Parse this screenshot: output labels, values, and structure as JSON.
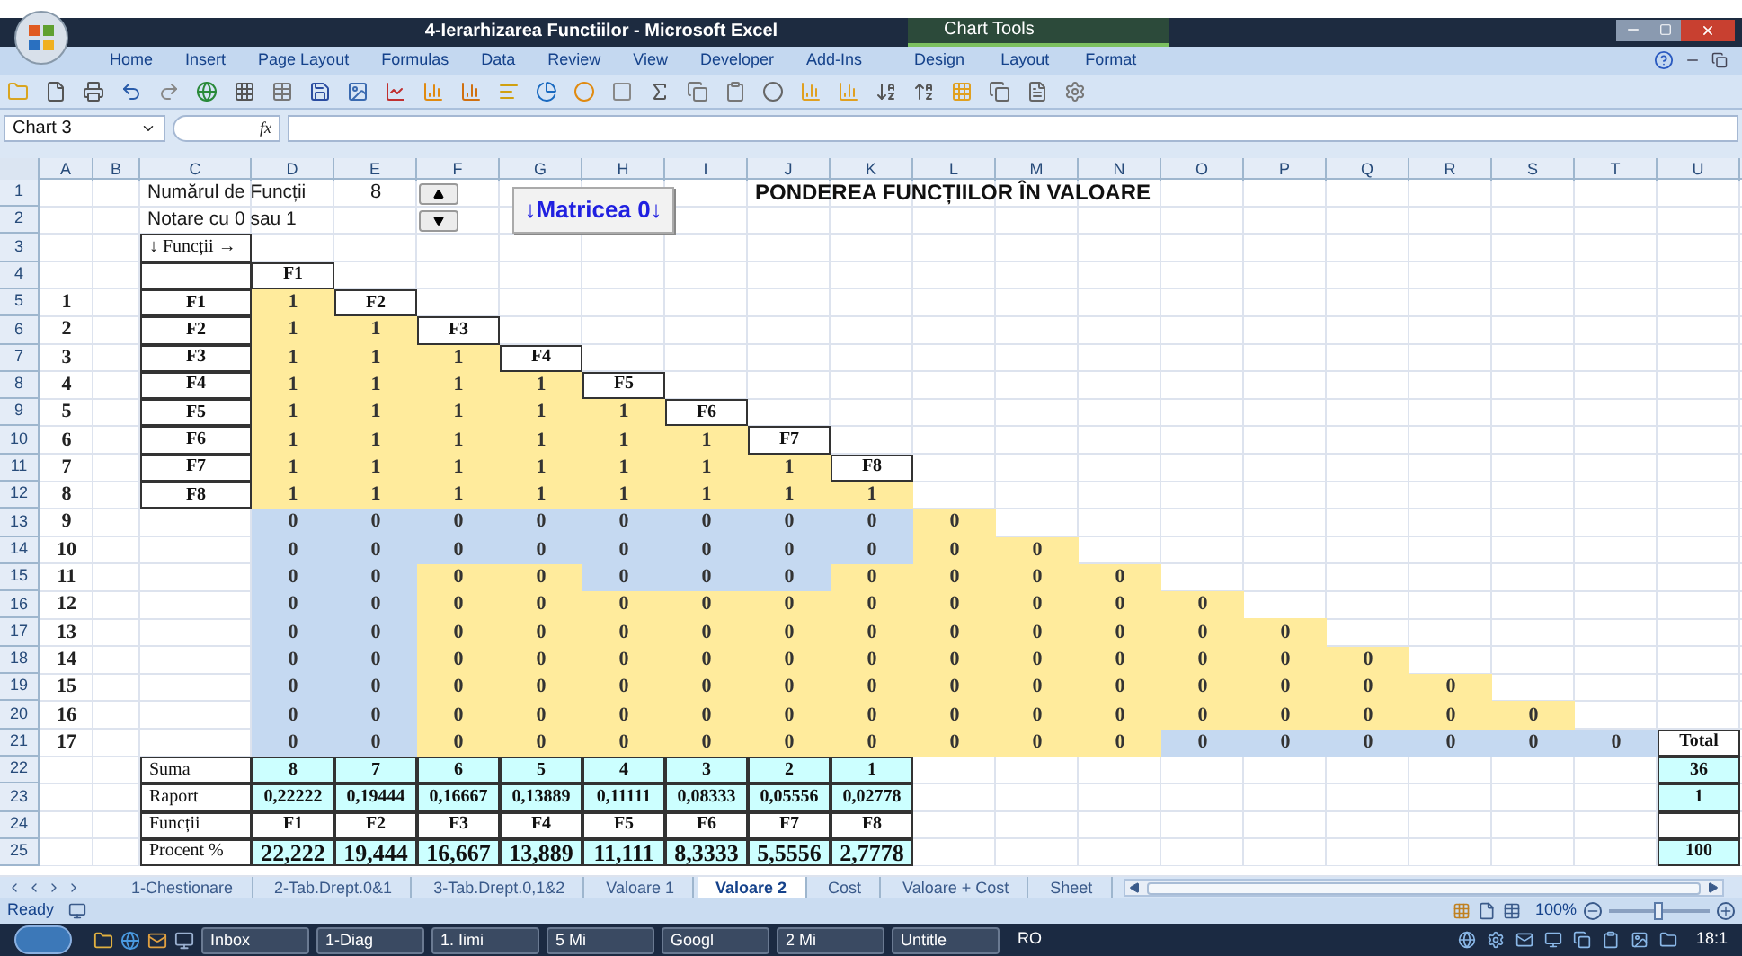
{
  "window": {
    "title": "4-Ierarhizarea Functiilor - Microsoft Excel"
  },
  "ribbon_tabs": [
    "Home",
    "Insert",
    "Page Layout",
    "Formulas",
    "Data",
    "Review",
    "View",
    "Developer",
    "Add-Ins"
  ],
  "contextual": {
    "title": "Chart Tools",
    "tabs": [
      "Design",
      "Layout",
      "Format"
    ]
  },
  "formula_bar": {
    "name_box": "Chart 3",
    "fx_label": "fx"
  },
  "columns": [
    "A",
    "B",
    "C",
    "D",
    "E",
    "F",
    "G",
    "H",
    "I",
    "J",
    "K",
    "L",
    "M",
    "N",
    "O",
    "P",
    "Q",
    "R",
    "S",
    "T",
    "U"
  ],
  "rows": [
    {
      "number": "1",
      "cells": [
        {},
        {},
        {
          "kind": "plain",
          "text": "Numărul de Funcții"
        },
        {},
        {
          "kind": "center",
          "text": "8"
        },
        {},
        {},
        {},
        {},
        {
          "kind": "title",
          "text": "PONDEREA FUNCȚIILOR ÎN VALOARE"
        },
        {},
        {},
        {},
        {},
        {},
        {},
        {},
        {},
        {},
        {},
        {}
      ]
    },
    {
      "number": "2",
      "cells": [
        {},
        {},
        {
          "kind": "plain",
          "text": "Notare cu 0 sau 1"
        },
        {},
        {},
        {},
        {},
        {},
        {},
        {},
        {},
        {},
        {},
        {},
        {},
        {},
        {},
        {},
        {},
        {},
        {}
      ]
    },
    {
      "number": "3",
      "cells": [
        {},
        {},
        {
          "kind": "label",
          "text": "↓ Funcții →"
        },
        {},
        {},
        {},
        {},
        {},
        {},
        {},
        {},
        {},
        {},
        {},
        {},
        {},
        {},
        {},
        {},
        {},
        {}
      ]
    },
    {
      "number": "4",
      "cells": [
        {},
        {},
        {
          "kind": "boxed"
        },
        {
          "kind": "boxed",
          "text": "F1"
        },
        {},
        {},
        {},
        {},
        {},
        {},
        {},
        {},
        {},
        {},
        {},
        {},
        {},
        {},
        {},
        {},
        {}
      ]
    },
    {
      "number": "5",
      "cells": [
        {
          "kind": "number",
          "text": "1"
        },
        {},
        {
          "kind": "boxed",
          "text": "F1"
        },
        {
          "kind": "yellow",
          "text": "1"
        },
        {
          "kind": "boxed",
          "text": "F2"
        },
        {},
        {},
        {},
        {},
        {},
        {},
        {},
        {},
        {},
        {},
        {},
        {},
        {},
        {},
        {},
        {}
      ]
    },
    {
      "number": "6",
      "cells": [
        {
          "kind": "number",
          "text": "2"
        },
        {},
        {
          "kind": "boxed",
          "text": "F2"
        },
        {
          "kind": "yellow",
          "text": "1"
        },
        {
          "kind": "yellow",
          "text": "1"
        },
        {
          "kind": "boxed",
          "text": "F3"
        },
        {},
        {},
        {},
        {},
        {},
        {},
        {},
        {},
        {},
        {},
        {},
        {},
        {},
        {},
        {}
      ]
    },
    {
      "number": "7",
      "cells": [
        {
          "kind": "number",
          "text": "3"
        },
        {},
        {
          "kind": "boxed",
          "text": "F3"
        },
        {
          "kind": "yellow",
          "text": "1"
        },
        {
          "kind": "yellow",
          "text": "1"
        },
        {
          "kind": "yellow",
          "text": "1"
        },
        {
          "kind": "boxed",
          "text": "F4"
        },
        {},
        {},
        {},
        {},
        {},
        {},
        {},
        {},
        {},
        {},
        {},
        {},
        {},
        {}
      ]
    },
    {
      "number": "8",
      "cells": [
        {
          "kind": "number",
          "text": "4"
        },
        {},
        {
          "kind": "boxed",
          "text": "F4"
        },
        {
          "kind": "yellow",
          "text": "1"
        },
        {
          "kind": "yellow",
          "text": "1"
        },
        {
          "kind": "yellow",
          "text": "1"
        },
        {
          "kind": "yellow",
          "text": "1"
        },
        {
          "kind": "boxed",
          "text": "F5"
        },
        {},
        {},
        {},
        {},
        {},
        {},
        {},
        {},
        {},
        {},
        {},
        {},
        {}
      ]
    },
    {
      "number": "9",
      "cells": [
        {
          "kind": "number",
          "text": "5"
        },
        {},
        {
          "kind": "boxed",
          "text": "F5"
        },
        {
          "kind": "yellow",
          "text": "1"
        },
        {
          "kind": "yellow",
          "text": "1"
        },
        {
          "kind": "yellow",
          "text": "1"
        },
        {
          "kind": "yellow",
          "text": "1"
        },
        {
          "kind": "yellow",
          "text": "1"
        },
        {
          "kind": "boxed",
          "text": "F6"
        },
        {},
        {},
        {},
        {},
        {},
        {},
        {},
        {},
        {},
        {},
        {},
        {}
      ]
    },
    {
      "number": "10",
      "cells": [
        {
          "kind": "number",
          "text": "6"
        },
        {},
        {
          "kind": "boxed",
          "text": "F6"
        },
        {
          "kind": "yellow",
          "text": "1"
        },
        {
          "kind": "yellow",
          "text": "1"
        },
        {
          "kind": "yellow",
          "text": "1"
        },
        {
          "kind": "yellow",
          "text": "1"
        },
        {
          "kind": "yellow",
          "text": "1"
        },
        {
          "kind": "yellow",
          "text": "1"
        },
        {
          "kind": "boxed",
          "text": "F7"
        },
        {},
        {},
        {},
        {},
        {},
        {},
        {},
        {},
        {},
        {},
        {}
      ]
    },
    {
      "number": "11",
      "cells": [
        {
          "kind": "number",
          "text": "7"
        },
        {},
        {
          "kind": "boxed",
          "text": "F7"
        },
        {
          "kind": "yellow",
          "text": "1"
        },
        {
          "kind": "yellow",
          "text": "1"
        },
        {
          "kind": "yellow",
          "text": "1"
        },
        {
          "kind": "yellow",
          "text": "1"
        },
        {
          "kind": "yellow",
          "text": "1"
        },
        {
          "kind": "yellow",
          "text": "1"
        },
        {
          "kind": "yellow",
          "text": "1"
        },
        {
          "kind": "boxed",
          "text": "F8"
        },
        {},
        {},
        {},
        {},
        {},
        {},
        {},
        {},
        {},
        {}
      ]
    },
    {
      "number": "12",
      "cells": [
        {
          "kind": "number",
          "text": "8"
        },
        {},
        {
          "kind": "boxed",
          "text": "F8"
        },
        {
          "kind": "yellow",
          "text": "1"
        },
        {
          "kind": "yellow",
          "text": "1"
        },
        {
          "kind": "yellow",
          "text": "1"
        },
        {
          "kind": "yellow",
          "text": "1"
        },
        {
          "kind": "yellow",
          "text": "1"
        },
        {
          "kind": "yellow",
          "text": "1"
        },
        {
          "kind": "yellow",
          "text": "1"
        },
        {
          "kind": "yellow",
          "text": "1"
        },
        {},
        {},
        {},
        {},
        {},
        {},
        {},
        {},
        {},
        {}
      ]
    },
    {
      "number": "13",
      "cells": [
        {
          "kind": "number",
          "text": "9"
        },
        {},
        {},
        {
          "kind": "blue",
          "text": "0"
        },
        {
          "kind": "blue",
          "text": "0"
        },
        {
          "kind": "blue",
          "text": "0"
        },
        {
          "kind": "blue",
          "text": "0"
        },
        {
          "kind": "blue",
          "text": "0"
        },
        {
          "kind": "blue",
          "text": "0"
        },
        {
          "kind": "blue",
          "text": "0"
        },
        {
          "kind": "blue",
          "text": "0"
        },
        {
          "kind": "yellow",
          "text": "0"
        },
        {},
        {},
        {},
        {},
        {},
        {},
        {},
        {},
        {}
      ]
    },
    {
      "number": "14",
      "cells": [
        {
          "kind": "number",
          "text": "10"
        },
        {},
        {},
        {
          "kind": "blue",
          "text": "0"
        },
        {
          "kind": "blue",
          "text": "0"
        },
        {
          "kind": "blue",
          "text": "0"
        },
        {
          "kind": "blue",
          "text": "0"
        },
        {
          "kind": "blue",
          "text": "0"
        },
        {
          "kind": "blue",
          "text": "0"
        },
        {
          "kind": "blue",
          "text": "0"
        },
        {
          "kind": "blue",
          "text": "0"
        },
        {
          "kind": "yellow",
          "text": "0"
        },
        {
          "kind": "yellow",
          "text": "0"
        },
        {},
        {},
        {},
        {},
        {},
        {},
        {},
        {}
      ]
    },
    {
      "number": "15",
      "cells": [
        {
          "kind": "number",
          "text": "11"
        },
        {},
        {},
        {
          "kind": "blue",
          "text": "0"
        },
        {
          "kind": "blue",
          "text": "0"
        },
        {
          "kind": "yellow",
          "text": "0"
        },
        {
          "kind": "yellow",
          "text": "0"
        },
        {
          "kind": "blue",
          "text": "0"
        },
        {
          "kind": "blue",
          "text": "0"
        },
        {
          "kind": "blue",
          "text": "0"
        },
        {
          "kind": "yellow",
          "text": "0"
        },
        {
          "kind": "yellow",
          "text": "0"
        },
        {
          "kind": "yellow",
          "text": "0"
        },
        {
          "kind": "yellow",
          "text": "0"
        },
        {},
        {},
        {},
        {},
        {},
        {},
        {}
      ]
    },
    {
      "number": "16",
      "cells": [
        {
          "kind": "number",
          "text": "12"
        },
        {},
        {},
        {
          "kind": "blue",
          "text": "0"
        },
        {
          "kind": "blue",
          "text": "0"
        },
        {
          "kind": "yellow",
          "text": "0"
        },
        {
          "kind": "yellow",
          "text": "0"
        },
        {
          "kind": "yellow",
          "text": "0"
        },
        {
          "kind": "yellow",
          "text": "0"
        },
        {
          "kind": "yellow",
          "text": "0"
        },
        {
          "kind": "yellow",
          "text": "0"
        },
        {
          "kind": "yellow",
          "text": "0"
        },
        {
          "kind": "yellow",
          "text": "0"
        },
        {
          "kind": "yellow",
          "text": "0"
        },
        {
          "kind": "yellow",
          "text": "0"
        },
        {},
        {},
        {},
        {},
        {},
        {}
      ]
    },
    {
      "number": "17",
      "cells": [
        {
          "kind": "number",
          "text": "13"
        },
        {},
        {},
        {
          "kind": "blue",
          "text": "0"
        },
        {
          "kind": "blue",
          "text": "0"
        },
        {
          "kind": "yellow",
          "text": "0"
        },
        {
          "kind": "yellow",
          "text": "0"
        },
        {
          "kind": "yellow",
          "text": "0"
        },
        {
          "kind": "yellow",
          "text": "0"
        },
        {
          "kind": "yellow",
          "text": "0"
        },
        {
          "kind": "yellow",
          "text": "0"
        },
        {
          "kind": "yellow",
          "text": "0"
        },
        {
          "kind": "yellow",
          "text": "0"
        },
        {
          "kind": "yellow",
          "text": "0"
        },
        {
          "kind": "yellow",
          "text": "0"
        },
        {
          "kind": "yellow",
          "text": "0"
        },
        {},
        {},
        {},
        {},
        {}
      ]
    },
    {
      "number": "18",
      "cells": [
        {
          "kind": "number",
          "text": "14"
        },
        {},
        {},
        {
          "kind": "blue",
          "text": "0"
        },
        {
          "kind": "blue",
          "text": "0"
        },
        {
          "kind": "yellow",
          "text": "0"
        },
        {
          "kind": "yellow",
          "text": "0"
        },
        {
          "kind": "yellow",
          "text": "0"
        },
        {
          "kind": "yellow",
          "text": "0"
        },
        {
          "kind": "yellow",
          "text": "0"
        },
        {
          "kind": "yellow",
          "text": "0"
        },
        {
          "kind": "yellow",
          "text": "0"
        },
        {
          "kind": "yellow",
          "text": "0"
        },
        {
          "kind": "yellow",
          "text": "0"
        },
        {
          "kind": "yellow",
          "text": "0"
        },
        {
          "kind": "yellow",
          "text": "0"
        },
        {
          "kind": "yellow",
          "text": "0"
        },
        {},
        {},
        {},
        {}
      ]
    },
    {
      "number": "19",
      "cells": [
        {
          "kind": "number",
          "text": "15"
        },
        {},
        {},
        {
          "kind": "blue",
          "text": "0"
        },
        {
          "kind": "blue",
          "text": "0"
        },
        {
          "kind": "yellow",
          "text": "0"
        },
        {
          "kind": "yellow",
          "text": "0"
        },
        {
          "kind": "yellow",
          "text": "0"
        },
        {
          "kind": "yellow",
          "text": "0"
        },
        {
          "kind": "yellow",
          "text": "0"
        },
        {
          "kind": "yellow",
          "text": "0"
        },
        {
          "kind": "yellow",
          "text": "0"
        },
        {
          "kind": "yellow",
          "text": "0"
        },
        {
          "kind": "yellow",
          "text": "0"
        },
        {
          "kind": "yellow",
          "text": "0"
        },
        {
          "kind": "yellow",
          "text": "0"
        },
        {
          "kind": "yellow",
          "text": "0"
        },
        {
          "kind": "yellow",
          "text": "0"
        },
        {},
        {},
        {}
      ]
    },
    {
      "number": "20",
      "cells": [
        {
          "kind": "number",
          "text": "16"
        },
        {},
        {},
        {
          "kind": "blue",
          "text": "0"
        },
        {
          "kind": "blue",
          "text": "0"
        },
        {
          "kind": "yellow",
          "text": "0"
        },
        {
          "kind": "yellow",
          "text": "0"
        },
        {
          "kind": "yellow",
          "text": "0"
        },
        {
          "kind": "yellow",
          "text": "0"
        },
        {
          "kind": "yellow",
          "text": "0"
        },
        {
          "kind": "yellow",
          "text": "0"
        },
        {
          "kind": "yellow",
          "text": "0"
        },
        {
          "kind": "yellow",
          "text": "0"
        },
        {
          "kind": "yellow",
          "text": "0"
        },
        {
          "kind": "yellow",
          "text": "0"
        },
        {
          "kind": "yellow",
          "text": "0"
        },
        {
          "kind": "yellow",
          "text": "0"
        },
        {
          "kind": "yellow",
          "text": "0"
        },
        {
          "kind": "yellow",
          "text": "0"
        },
        {},
        {}
      ]
    },
    {
      "number": "21",
      "cells": [
        {
          "kind": "number",
          "text": "17"
        },
        {},
        {},
        {
          "kind": "blue",
          "text": "0"
        },
        {
          "kind": "blue",
          "text": "0"
        },
        {
          "kind": "yellow",
          "text": "0"
        },
        {
          "kind": "yellow",
          "text": "0"
        },
        {
          "kind": "yellow",
          "text": "0"
        },
        {
          "kind": "yellow",
          "text": "0"
        },
        {
          "kind": "yellow",
          "text": "0"
        },
        {
          "kind": "yellow",
          "text": "0"
        },
        {
          "kind": "yellow",
          "text": "0"
        },
        {
          "kind": "yellow",
          "text": "0"
        },
        {
          "kind": "yellow",
          "text": "0"
        },
        {
          "kind": "blue",
          "text": "0"
        },
        {
          "kind": "blue",
          "text": "0"
        },
        {
          "kind": "blue",
          "text": "0"
        },
        {
          "kind": "blue",
          "text": "0"
        },
        {
          "kind": "blue",
          "text": "0"
        },
        {
          "kind": "blue",
          "text": "0"
        },
        {
          "kind": "boxed",
          "text": "Total"
        }
      ]
    },
    {
      "number": "22",
      "cells": [
        {},
        {},
        {
          "kind": "label",
          "text": "Suma"
        },
        {
          "kind": "cyan",
          "text": "8"
        },
        {
          "kind": "cyan",
          "text": "7"
        },
        {
          "kind": "cyan",
          "text": "6"
        },
        {
          "kind": "cyan",
          "text": "5"
        },
        {
          "kind": "cyan",
          "text": "4"
        },
        {
          "kind": "cyan",
          "text": "3"
        },
        {
          "kind": "cyan",
          "text": "2"
        },
        {
          "kind": "cyan",
          "text": "1"
        },
        {},
        {},
        {},
        {},
        {},
        {},
        {},
        {},
        {},
        {
          "kind": "cyan",
          "text": "36"
        }
      ]
    },
    {
      "number": "23",
      "cells": [
        {},
        {},
        {
          "kind": "label",
          "text": "Raport"
        },
        {
          "kind": "cyan",
          "text": "0,22222"
        },
        {
          "kind": "cyan",
          "text": "0,19444"
        },
        {
          "kind": "cyan",
          "text": "0,16667"
        },
        {
          "kind": "cyan",
          "text": "0,13889"
        },
        {
          "kind": "cyan",
          "text": "0,11111"
        },
        {
          "kind": "cyan",
          "text": "0,08333"
        },
        {
          "kind": "cyan",
          "text": "0,05556"
        },
        {
          "kind": "cyan",
          "text": "0,02778"
        },
        {},
        {},
        {},
        {},
        {},
        {},
        {},
        {},
        {},
        {
          "kind": "cyan",
          "text": "1"
        }
      ]
    },
    {
      "number": "24",
      "cells": [
        {},
        {},
        {
          "kind": "label",
          "text": "Funcții"
        },
        {
          "kind": "boxed",
          "text": "F1"
        },
        {
          "kind": "boxed",
          "text": "F2"
        },
        {
          "kind": "boxed",
          "text": "F3"
        },
        {
          "kind": "boxed",
          "text": "F4"
        },
        {
          "kind": "boxed",
          "text": "F5"
        },
        {
          "kind": "boxed",
          "text": "F6"
        },
        {
          "kind": "boxed",
          "text": "F7"
        },
        {
          "kind": "boxed",
          "text": "F8"
        },
        {},
        {},
        {},
        {},
        {},
        {},
        {},
        {},
        {},
        {
          "kind": "boxed"
        }
      ]
    },
    {
      "number": "25",
      "cells": [
        {},
        {},
        {
          "kind": "label",
          "text": "Procent %"
        },
        {
          "kind": "big",
          "text": "22,222"
        },
        {
          "kind": "big",
          "text": "19,444"
        },
        {
          "kind": "big",
          "text": "16,667"
        },
        {
          "kind": "big",
          "text": "13,889"
        },
        {
          "kind": "big",
          "text": "11,111"
        },
        {
          "kind": "big",
          "text": "8,3333"
        },
        {
          "kind": "big",
          "text": "5,5556"
        },
        {
          "kind": "big",
          "text": "2,7778"
        },
        {},
        {},
        {},
        {},
        {},
        {},
        {},
        {},
        {},
        {
          "kind": "cyan",
          "text": "100"
        }
      ]
    }
  ],
  "sheet_button": {
    "label": "↓Matricea 0↓"
  },
  "sheet_tabs": [
    {
      "label": "1-Chestionare",
      "selected": false
    },
    {
      "label": "2-Tab.Drept.0&1",
      "selected": false
    },
    {
      "label": "3-Tab.Drept.0,1&2",
      "selected": false
    },
    {
      "label": "Valoare 1",
      "selected": false
    },
    {
      "label": "Valoare 2",
      "selected": true
    },
    {
      "label": "Cost",
      "selected": false
    },
    {
      "label": "Valoare + Cost",
      "selected": false
    },
    {
      "label": "Sheet",
      "selected": false
    }
  ],
  "status_bar": {
    "status": "Ready",
    "zoom": {
      "label": "100%",
      "level": 0.5
    }
  },
  "taskbar": {
    "items": [
      "Inbox",
      "1-Diag",
      "1. Iimi",
      "5 Mi",
      "Googl",
      "2 Mi",
      "Untitle"
    ],
    "language": "RO",
    "clock": "18:1"
  }
}
